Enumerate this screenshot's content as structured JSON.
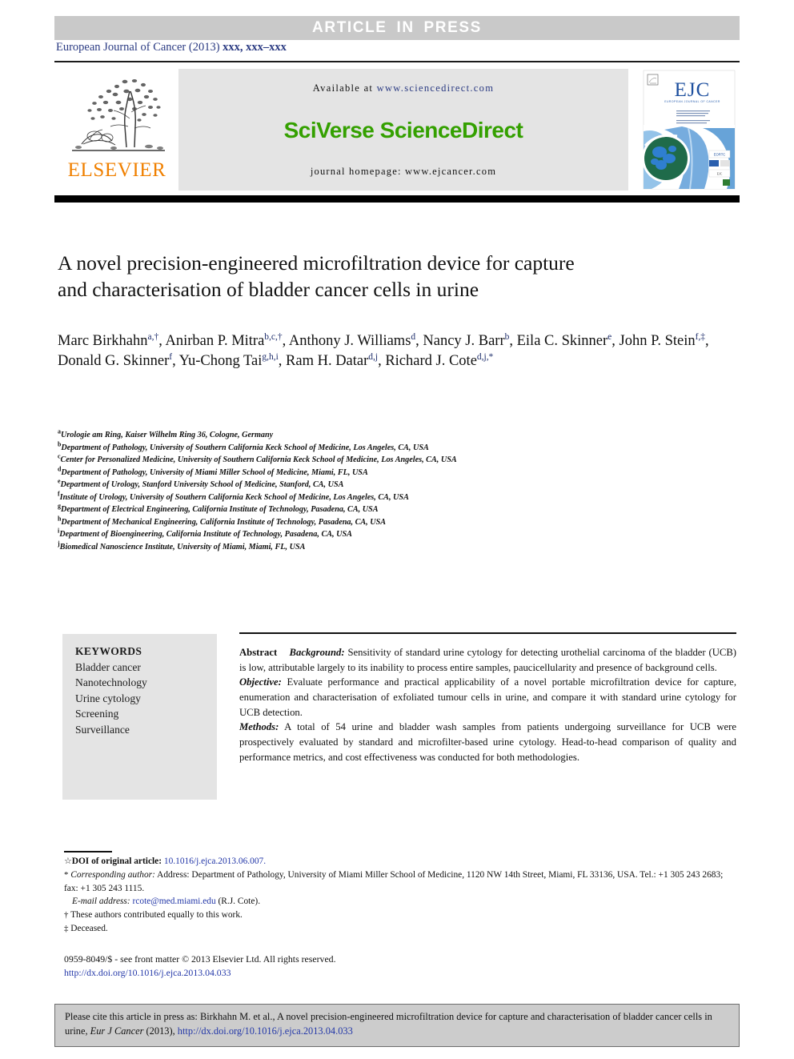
{
  "banner": {
    "text": "ARTICLE IN PRESS"
  },
  "journal_line": {
    "name": "European Journal of Cancer (2013)",
    "volume_pages": "xxx, xxx–xxx"
  },
  "masthead": {
    "publisher_name": "ELSEVIER",
    "available_at_label": "Available at",
    "available_at_url": "www.sciencedirect.com",
    "platform_logo": "SciVerse ScienceDirect",
    "homepage_label": "journal homepage:",
    "homepage_url": "www.ejcancer.com",
    "cover_title": "EJC",
    "cover_subtitle": "EUROPEAN JOURNAL OF CANCER"
  },
  "article": {
    "title_line1": "A novel precision-engineered microfiltration device for capture",
    "title_line2": "and characterisation of bladder cancer cells in urine"
  },
  "authors": [
    {
      "name": "Marc Birkhahn",
      "sup": "a,†",
      "sep": ", "
    },
    {
      "name": "Anirban P. Mitra",
      "sup": "b,c,†",
      "sep": ", "
    },
    {
      "name": "Anthony J. Williams",
      "sup": "d",
      "sep": ", "
    },
    {
      "name": "Nancy J. Barr",
      "sup": "b",
      "sep": ", "
    },
    {
      "name": "Eila C. Skinner",
      "sup": "e",
      "sep": ", "
    },
    {
      "name": "John P. Stein",
      "sup": "f,‡",
      "sep": ", "
    },
    {
      "name": "Donald G. Skinner",
      "sup": "f",
      "sep": ", "
    },
    {
      "name": "Yu-Chong Tai",
      "sup": "g,h,i",
      "sep": ", "
    },
    {
      "name": "Ram H. Datar",
      "sup": "d,j",
      "sep": ", "
    },
    {
      "name": "Richard J. Cote",
      "sup": "d,j,*",
      "sep": ""
    }
  ],
  "affiliations": [
    {
      "mark": "a",
      "text": "Urologie am Ring, Kaiser Wilhelm Ring 36, Cologne, Germany"
    },
    {
      "mark": "b",
      "text": "Department of Pathology, University of Southern California Keck School of Medicine, Los Angeles, CA, USA"
    },
    {
      "mark": "c",
      "text": "Center for Personalized Medicine, University of Southern California Keck School of Medicine, Los Angeles, CA, USA"
    },
    {
      "mark": "d",
      "text": "Department of Pathology, University of Miami Miller School of Medicine, Miami, FL, USA"
    },
    {
      "mark": "e",
      "text": "Department of Urology, Stanford University School of Medicine, Stanford, CA, USA"
    },
    {
      "mark": "f",
      "text": "Institute of Urology, University of Southern California Keck School of Medicine, Los Angeles, CA, USA"
    },
    {
      "mark": "g",
      "text": "Department of Electrical Engineering, California Institute of Technology, Pasadena, CA, USA"
    },
    {
      "mark": "h",
      "text": "Department of Mechanical Engineering, California Institute of Technology, Pasadena, CA, USA"
    },
    {
      "mark": "i",
      "text": "Department of Bioengineering, California Institute of Technology, Pasadena, CA, USA"
    },
    {
      "mark": "j",
      "text": "Biomedical Nanoscience Institute, University of Miami, Miami, FL, USA"
    }
  ],
  "keywords": {
    "heading": "KEYWORDS",
    "items": [
      "Bladder cancer",
      "Nanotechnology",
      "Urine cytology",
      "Screening",
      "Surveillance"
    ]
  },
  "abstract": {
    "label": "Abstract",
    "sections": [
      {
        "heading": "Background:",
        "body": "Sensitivity of standard urine cytology for detecting urothelial carcinoma of the bladder (UCB) is low, attributable largely to its inability to process entire samples, paucicellularity and presence of background cells."
      },
      {
        "heading": "Objective:",
        "body": "Evaluate performance and practical applicability of a novel portable microfiltration device for capture, enumeration and characterisation of exfoliated tumour cells in urine, and compare it with standard urine cytology for UCB detection."
      },
      {
        "heading": "Methods:",
        "body": "A total of 54 urine and bladder wash samples from patients undergoing surveillance for UCB were prospectively evaluated by standard and microfilter-based urine cytology. Head-to-head comparison of quality and performance metrics, and cost effectiveness was conducted for both methodologies."
      }
    ]
  },
  "footnotes": {
    "doi_original_mark": "☆",
    "doi_original_label": "DOI of original article:",
    "doi_original_value": "10.1016/j.ejca.2013.06.007.",
    "corresponding_mark": "*",
    "corresponding_label": "Corresponding author:",
    "corresponding_text": "Address: Department of Pathology, University of Miami Miller School of Medicine, 1120 NW 14th Street, Miami, FL 33136, USA. Tel.: +1 305 243 2683; fax: +1 305 243 1115.",
    "email_label": "E-mail address:",
    "email_value": "rcote@med.miami.edu",
    "email_owner": "(R.J. Cote).",
    "equal_mark": "†",
    "equal_text": "These authors contributed equally to this work.",
    "deceased_mark": "‡",
    "deceased_text": "Deceased."
  },
  "copyright": {
    "line1": "0959-8049/$ - see front matter © 2013 Elsevier Ltd. All rights reserved.",
    "doi_url": "http://dx.doi.org/10.1016/j.ejca.2013.04.033"
  },
  "citation": {
    "prefix": "Please cite this article in press as: Birkhahn M. et al., A novel precision-engineered microfiltration device for capture and characterisation of bladder cancer cells in urine,",
    "journal": "Eur J Cancer",
    "year": "(2013),",
    "url": "http://dx.doi.org/10.1016/j.ejca.2013.04.033"
  },
  "colors": {
    "banner_bg": "#c9c9c9",
    "journal_blue": "#2a3a82",
    "sciverse_green": "#34a000",
    "elsevier_orange": "#f08000",
    "link_blue": "#2438a8",
    "box_gray": "#e4e4e4",
    "cite_gray": "#cccccc"
  }
}
